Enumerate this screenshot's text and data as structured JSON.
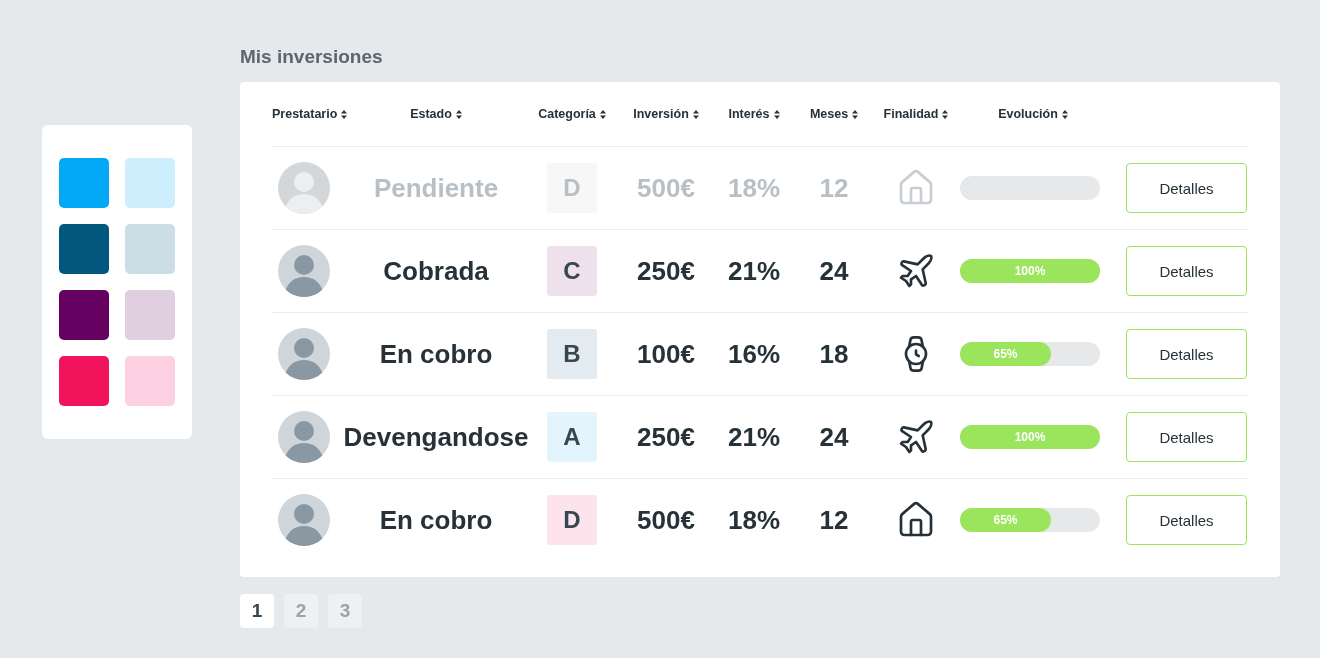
{
  "palette": [
    {
      "color": "#03a9f4"
    },
    {
      "color": "#cdeefd"
    },
    {
      "color": "#01577e"
    },
    {
      "color": "#cbdde5"
    },
    {
      "color": "#650160"
    },
    {
      "color": "#e0cfe1"
    },
    {
      "color": "#f1145c"
    },
    {
      "color": "#fdd1e1"
    }
  ],
  "title": "Mis inversiones",
  "table": {
    "columns": [
      "Prestatario",
      "Estado",
      "Categoría",
      "Inversión",
      "Interés",
      "Meses",
      "Finalidad",
      "Evolución"
    ],
    "rows": [
      {
        "disabled": true,
        "status": "Pendiente",
        "category": "D",
        "color": "#f7f7f7",
        "investment": "500€",
        "interest": "18%",
        "months": "12",
        "kind": "house",
        "action": "Detalles"
      },
      {
        "disabled": false,
        "status": "Cobrada",
        "category": "C",
        "color": "#efe1ec",
        "investment": "250€",
        "interest": "21%",
        "months": "24",
        "kind": "plane",
        "level": 1,
        "label": "100%",
        "action": "Detalles"
      },
      {
        "disabled": false,
        "status": "En cobro",
        "category": "B",
        "color": "#e3ebf1",
        "investment": "100€",
        "interest": "16%",
        "months": "18",
        "kind": "watch",
        "level": 0.65,
        "label": "65%",
        "action": "Detalles"
      },
      {
        "disabled": false,
        "status": "Devengandose",
        "category": "A",
        "color": "#e4f4fd",
        "investment": "250€",
        "interest": "21%",
        "months": "24",
        "kind": "plane",
        "level": 1,
        "label": "100%",
        "action": "Detalles"
      },
      {
        "disabled": false,
        "status": "En cobro",
        "category": "D",
        "color": "#fde4ec",
        "investment": "500€",
        "interest": "18%",
        "months": "12",
        "kind": "house",
        "level": 0.65,
        "label": "65%",
        "action": "Detalles"
      }
    ]
  },
  "pagination": [
    {
      "label": "1",
      "selected": true
    },
    {
      "label": "2",
      "selected": false
    },
    {
      "label": "3",
      "selected": false
    }
  ]
}
